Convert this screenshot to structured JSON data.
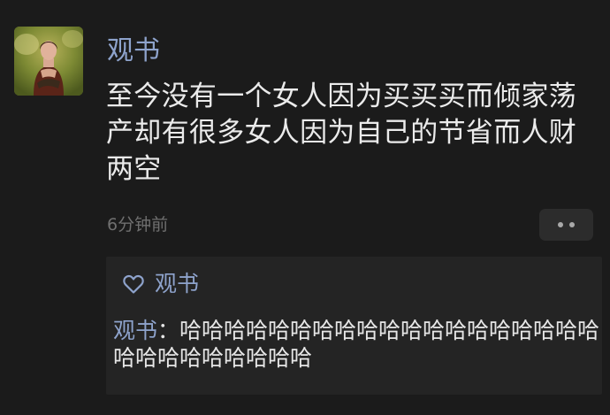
{
  "post": {
    "author": "观书",
    "text": "至今没有一个女人因为买买买而倾家荡产却有很多女人因为自己的节省而人财两空",
    "time": "6分钟前"
  },
  "icons": {
    "more": "more-dots-icon",
    "like": "heart-icon"
  },
  "likes": {
    "users": [
      "观书"
    ]
  },
  "comments": [
    {
      "author": "观书",
      "separator": "：",
      "text": "哈哈哈哈哈哈哈哈哈哈哈哈哈哈哈哈哈哈哈哈哈哈哈哈哈哈哈哈"
    }
  ],
  "colors": {
    "background": "#1b1b1b",
    "panel": "#242424",
    "name": "#8ea3cc",
    "text": "#ebebeb",
    "muted": "#6f6f6f"
  }
}
